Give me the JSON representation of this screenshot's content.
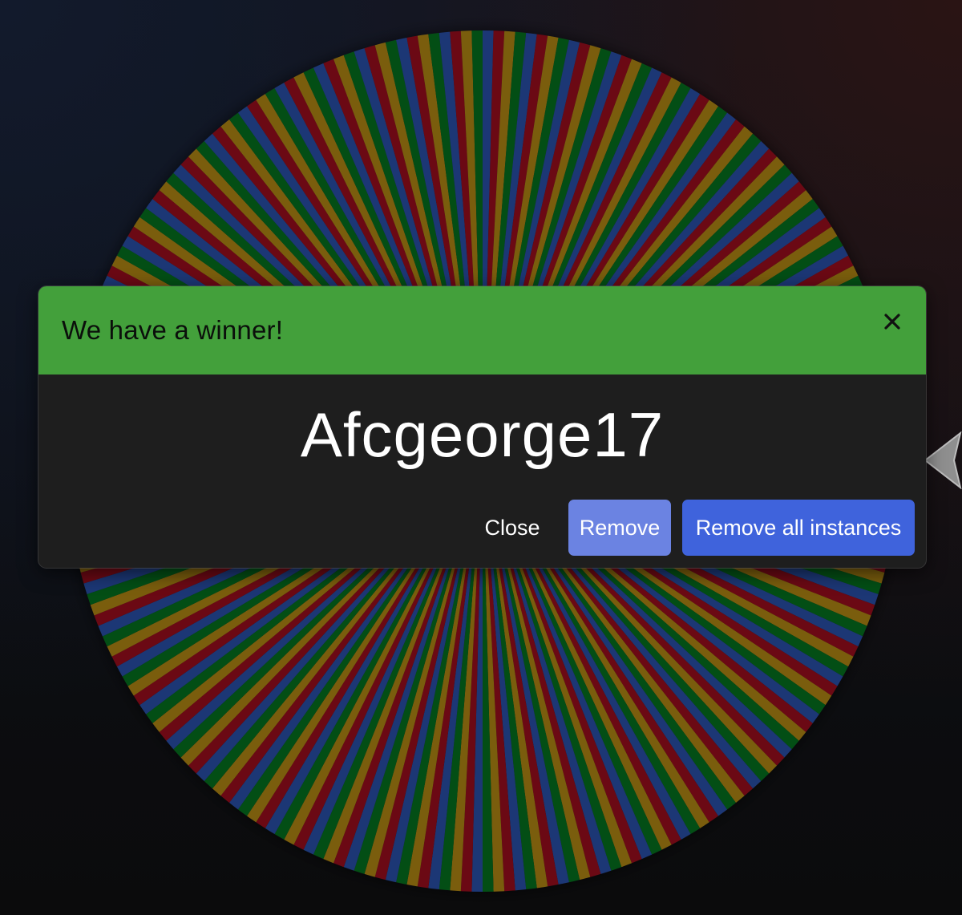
{
  "dialog": {
    "title": "We have a winner!",
    "close_icon": "close-icon",
    "winner": "Afcgeorge17",
    "buttons": {
      "close": "Close",
      "remove": "Remove",
      "remove_all": "Remove all instances"
    }
  },
  "wheel": {
    "segment_colors": [
      "#3369e8",
      "#d50f25",
      "#eeb211",
      "#009925"
    ],
    "pointer_icon": "wheel-pointer-icon"
  },
  "colors": {
    "header_green": "#43a03b",
    "dialog_body": "#1e1e1e",
    "remove_button": "#6b83e2",
    "remove_all_button": "#3f63dc"
  }
}
